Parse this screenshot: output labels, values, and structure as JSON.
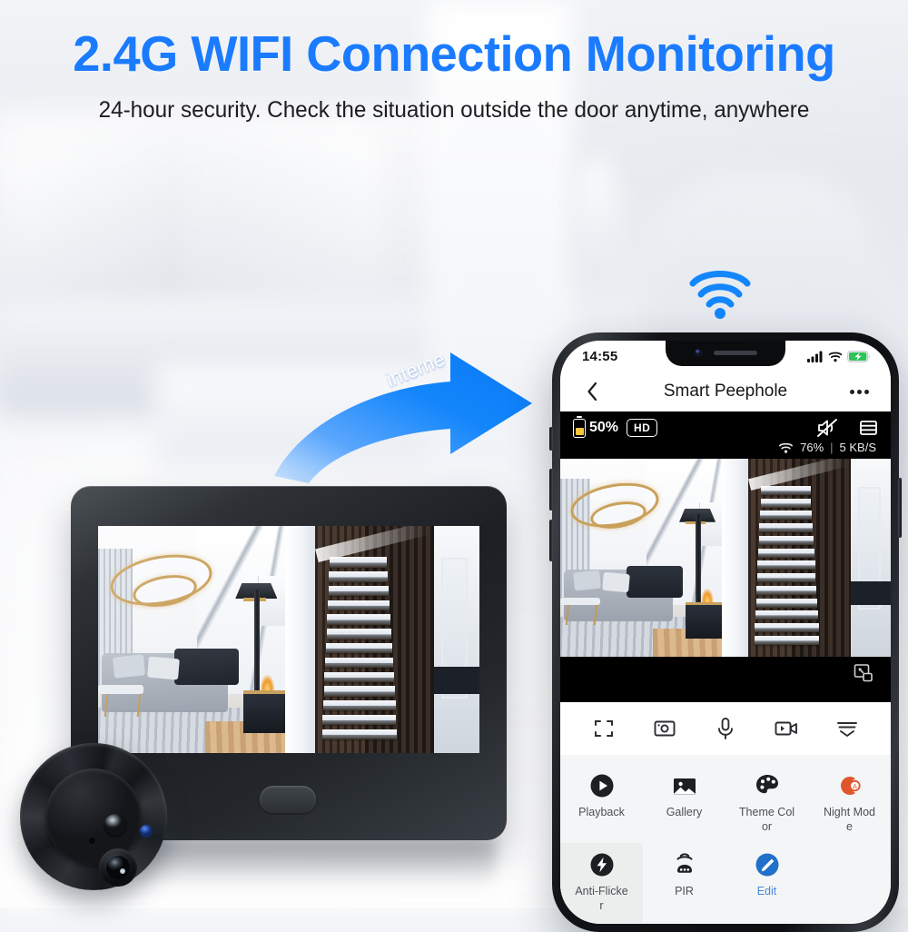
{
  "hero": {
    "headline": "2.4G WIFI Connection Monitoring",
    "subheadline": "24-hour security. Check the situation outside the door anytime, anywhere",
    "headline_color": "#1a7bff",
    "subheadline_color": "#1d1d1f"
  },
  "connection": {
    "arrow_label": "interne",
    "arrow_color": "#1386fb",
    "wifi_icon": "wifi-icon",
    "wifi_color": "#1386fb"
  },
  "device": {
    "name": "peephole-monitor",
    "home_button": "home-button",
    "camera_module": {
      "name": "camera-module",
      "pir_sensor": "pir-dome-sensor",
      "led": "status-led",
      "led_color": "#2f55b4",
      "microphone": "microphone-hole",
      "lens": "camera-lens"
    }
  },
  "phone": {
    "status_bar": {
      "time": "14:55",
      "signal_icon": "cellular-signal-icon",
      "wifi_icon": "wifi-icon",
      "battery_icon": "battery-charging-icon",
      "battery_color": "#2fc25b"
    },
    "header": {
      "back_icon": "chevron-left-icon",
      "title": "Smart Peephole",
      "more_icon": "more-options-icon"
    },
    "video_toolbar": {
      "battery_icon": "battery-icon",
      "battery_level": "50%",
      "battery_fill_color": "#f5c63c",
      "quality_badge": "HD",
      "mute_icon": "speaker-muted-icon",
      "list_icon": "stream-list-icon",
      "network_wifi_icon": "wifi-icon",
      "network_strength": "76%",
      "network_divider": "|",
      "network_speed": "5 KB/S"
    },
    "video": {
      "pip_icon": "picture-in-picture-icon"
    },
    "controls": [
      {
        "icon": "fullscreen-icon",
        "name": "fullscreen-button"
      },
      {
        "icon": "snapshot-icon",
        "name": "snapshot-button"
      },
      {
        "icon": "microphone-icon",
        "name": "talk-button"
      },
      {
        "icon": "record-video-icon",
        "name": "record-button"
      },
      {
        "icon": "collapse-icon",
        "name": "collapse-button"
      }
    ],
    "features": [
      {
        "label": "Playback",
        "icon": "play-circle-icon",
        "accent": false,
        "highlight": false
      },
      {
        "label": "Gallery",
        "icon": "image-icon",
        "accent": false,
        "highlight": false
      },
      {
        "label": "Theme Color",
        "icon": "palette-icon",
        "accent": false,
        "highlight": false
      },
      {
        "label": "Night Mode",
        "icon": "night-mode-icon",
        "accent": false,
        "highlight": false
      },
      {
        "label": "Anti-Flicker",
        "icon": "flash-icon",
        "accent": false,
        "highlight": true
      },
      {
        "label": "PIR",
        "icon": "pir-sensor-icon",
        "accent": false,
        "highlight": false
      },
      {
        "label": "Edit",
        "icon": "edit-pencil-icon",
        "accent": true,
        "highlight": false
      }
    ]
  }
}
